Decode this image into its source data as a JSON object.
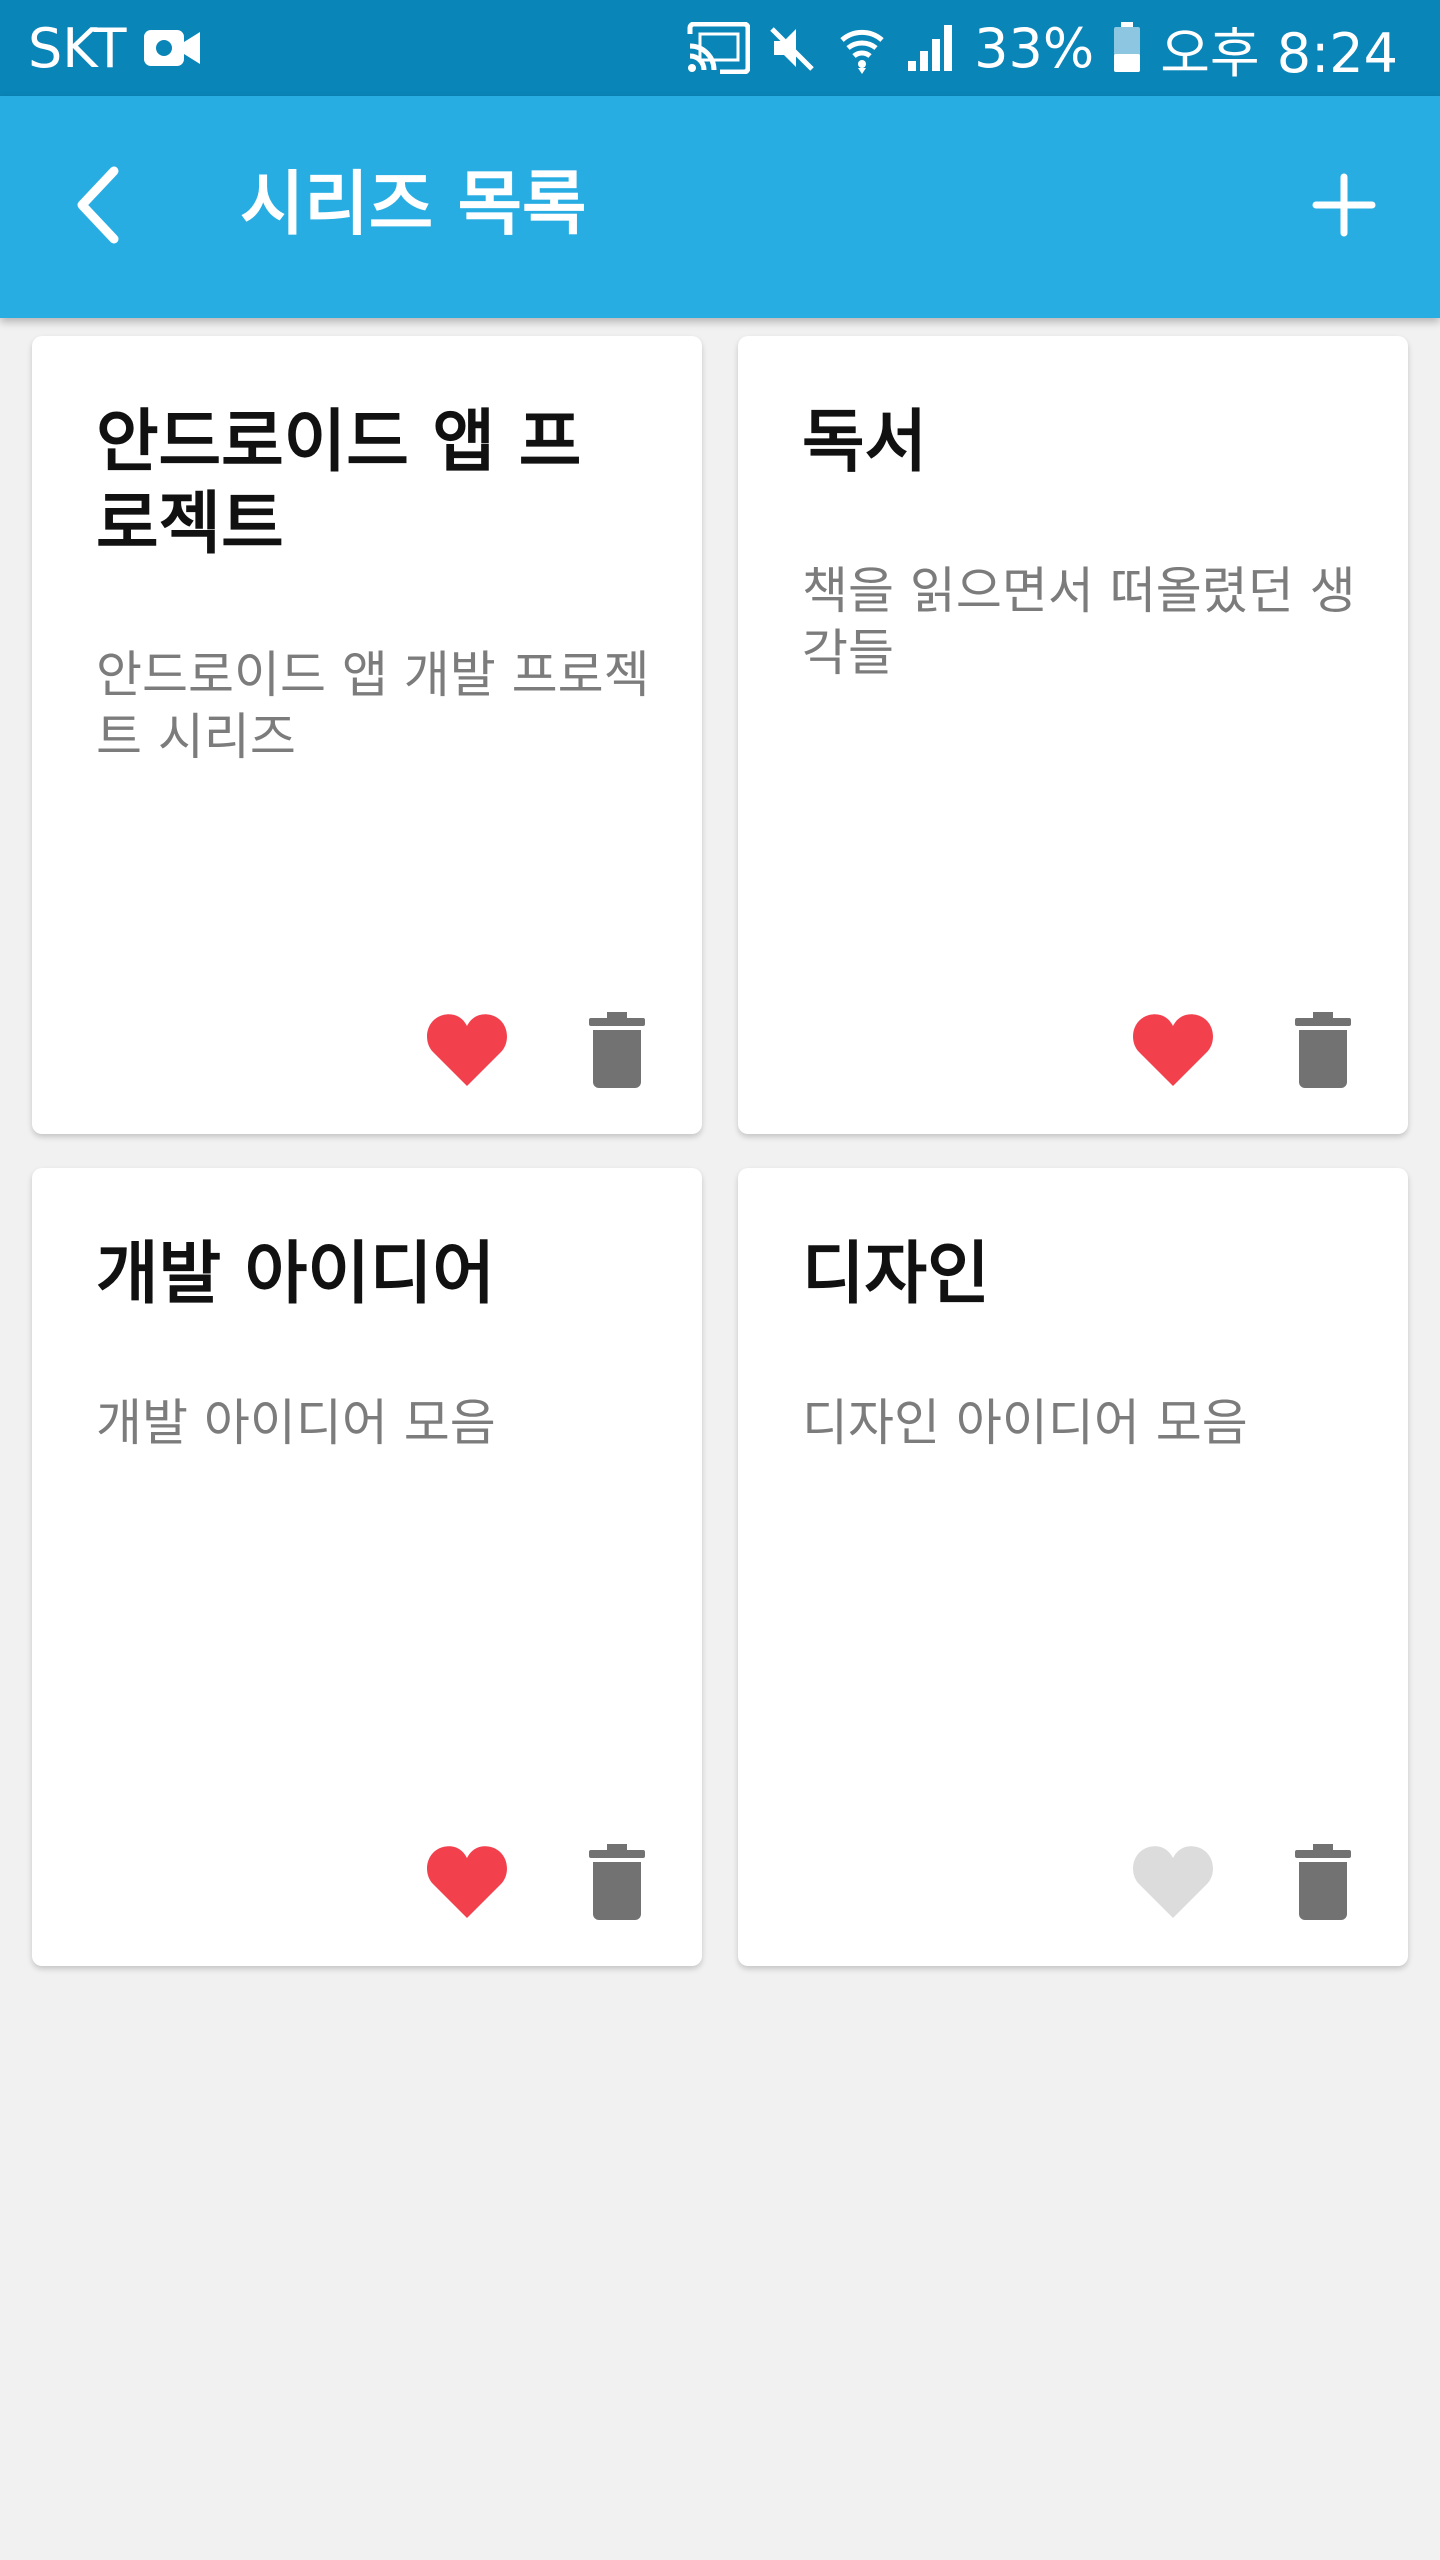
{
  "status_bar": {
    "carrier": "SKT",
    "battery": "33%",
    "time": "오후 8:24",
    "icons": [
      "video-camera-icon",
      "cast-icon",
      "mute-icon",
      "wifi-icon",
      "signal-icon",
      "battery-icon"
    ]
  },
  "app_bar": {
    "title": "시리즈 목록",
    "back_icon": "chevron-left-icon",
    "add_icon": "plus-icon",
    "color": "#28ade3"
  },
  "series": [
    {
      "title": "안드로이드 앱 프로젝트",
      "description": "안드로이드 앱 개발 프로젝트 시리즈",
      "favorite": true
    },
    {
      "title": "독서",
      "description": "책을 읽으면서 떠올렸던 생각들",
      "favorite": true
    },
    {
      "title": "개발 아이디어",
      "description": "개발 아이디어 모음",
      "favorite": true
    },
    {
      "title": "디자인",
      "description": "디자인 아이디어 모음",
      "favorite": false
    }
  ],
  "colors": {
    "favorite_on": "#f2414d",
    "favorite_off": "#dcdcdc",
    "trash": "#727272"
  }
}
